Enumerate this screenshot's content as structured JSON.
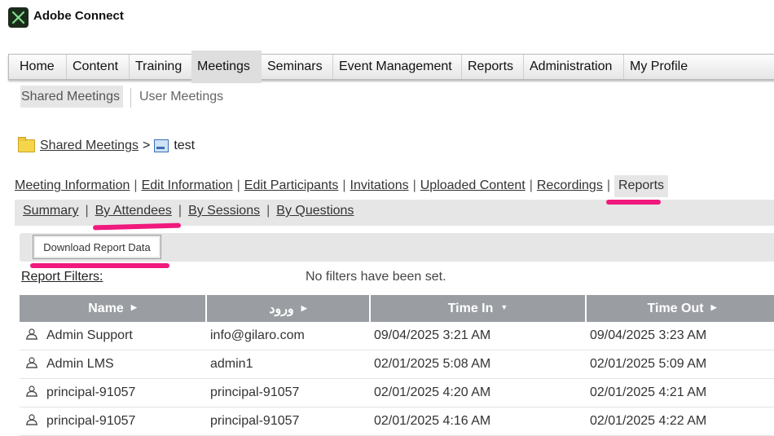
{
  "app": {
    "title": "Adobe Connect"
  },
  "main_nav": {
    "items": [
      "Home",
      "Content",
      "Training",
      "Meetings",
      "Seminars",
      "Event Management",
      "Reports",
      "Administration",
      "My Profile"
    ],
    "active": "Meetings"
  },
  "sub_nav": {
    "shared": "Shared Meetings",
    "user": "User Meetings"
  },
  "breadcrumb": {
    "parent": "Shared Meetings",
    "separator": ">",
    "current": "test"
  },
  "meeting_tabs": {
    "items": [
      "Meeting Information",
      "Edit Information",
      "Edit Participants",
      "Invitations",
      "Uploaded Content",
      "Recordings",
      "Reports"
    ],
    "active": "Reports"
  },
  "report_tabs": {
    "items": [
      "Summary",
      "By Attendees",
      "By Sessions",
      "By Questions"
    ]
  },
  "toolbar": {
    "download_label": "Download Report Data"
  },
  "filters": {
    "label": "Report Filters:",
    "value": "No filters have been set."
  },
  "table": {
    "columns": [
      "Name",
      "ورود",
      "Time In",
      "Time Out"
    ],
    "sort_icons": [
      "▶",
      "▶",
      "▼",
      "▶"
    ],
    "rows": [
      [
        "Admin Support",
        "info@gilaro.com",
        "09/04/2025 3:21 AM",
        "09/04/2025 3:23 AM"
      ],
      [
        "Admin LMS",
        "admin1",
        "02/01/2025 5:08 AM",
        "02/01/2025 5:09 AM"
      ],
      [
        "principal-91057",
        "principal-91057",
        "02/01/2025 4:20 AM",
        "02/01/2025 4:21 AM"
      ],
      [
        "principal-91057",
        "principal-91057",
        "02/01/2025 4:16 AM",
        "02/01/2025 4:22 AM"
      ]
    ]
  },
  "colors": {
    "highlight": "#f0197d",
    "header_bg": "#9a9ea3",
    "band_bg": "#e6e6e6"
  }
}
